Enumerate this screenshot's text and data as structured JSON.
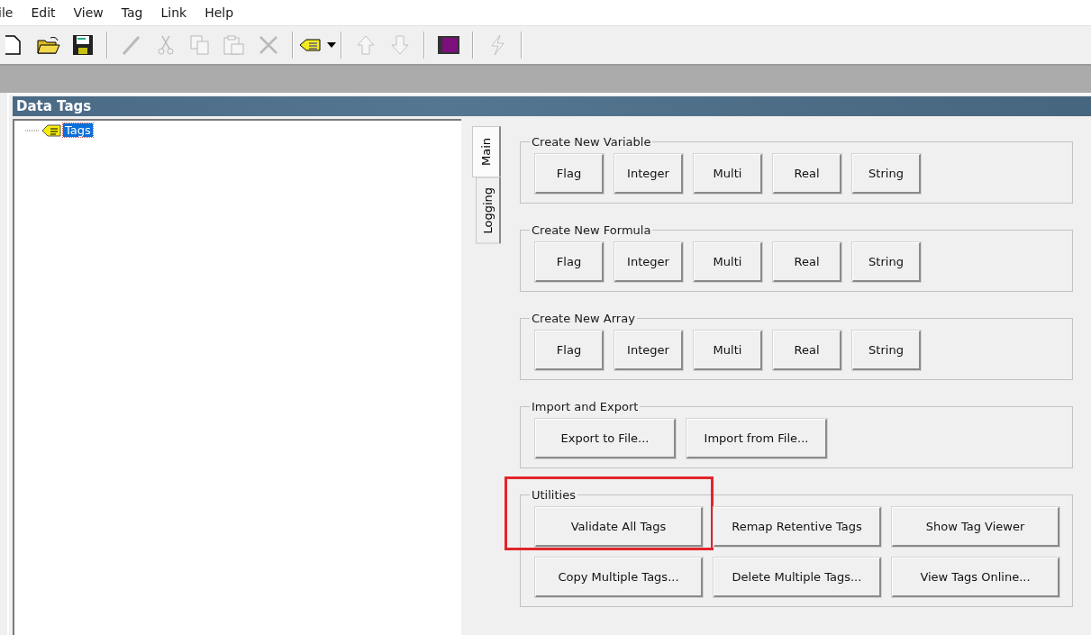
{
  "menu": [
    "ile",
    "Edit",
    "View",
    "Tag",
    "Link",
    "Help"
  ],
  "toolbar": [
    {
      "disabled": false
    },
    {
      "disabled": false
    },
    {
      "disabled": false
    },
    {
      "disabled": true
    },
    {
      "disabled": true
    },
    {
      "disabled": true
    },
    {
      "disabled": true
    },
    {
      "disabled": true
    },
    {
      "disabled": false
    },
    {
      "disabled": true
    },
    {
      "disabled": true
    },
    {
      "disabled": false
    },
    {
      "disabled": true
    }
  ],
  "window": {
    "title": "Data Tags"
  },
  "tree": [
    {
      "label": "Tags",
      "selected": true
    }
  ],
  "tabs": [
    {
      "label": "Main",
      "selected": true
    },
    {
      "label": "Logging",
      "selected": false
    }
  ],
  "groups": [
    {
      "title": "Create New Variable",
      "kind": "small",
      "buttons": [
        {
          "label": "Flag"
        },
        {
          "label": "Integer"
        },
        {
          "label": "Multi"
        },
        {
          "label": "Real"
        },
        {
          "label": "String"
        }
      ]
    },
    {
      "title": "Create New Formula",
      "kind": "small",
      "buttons": [
        {
          "label": "Flag"
        },
        {
          "label": "Integer"
        },
        {
          "label": "Multi"
        },
        {
          "label": "Real"
        },
        {
          "label": "String"
        }
      ]
    },
    {
      "title": "Create New Array",
      "kind": "small",
      "buttons": [
        {
          "label": "Flag"
        },
        {
          "label": "Integer"
        },
        {
          "label": "Multi"
        },
        {
          "label": "Real"
        },
        {
          "label": "String"
        }
      ]
    },
    {
      "title": "Import and Export",
      "kind": "medium",
      "buttons": [
        {
          "label": "Export to File..."
        },
        {
          "label": "Import from File..."
        }
      ]
    },
    {
      "title": "Utilities",
      "kind": "large",
      "buttons": [
        {
          "label": "Validate All Tags",
          "highlighted": true
        },
        {
          "label": "Remap Retentive Tags",
          "highlighted": false
        },
        {
          "label": "Show Tag Viewer",
          "highlighted": false
        },
        {
          "label": "Copy Multiple Tags...",
          "highlighted": false
        },
        {
          "label": "Delete Multiple Tags...",
          "highlighted": false
        },
        {
          "label": "View Tags Online...",
          "highlighted": false
        }
      ]
    }
  ]
}
